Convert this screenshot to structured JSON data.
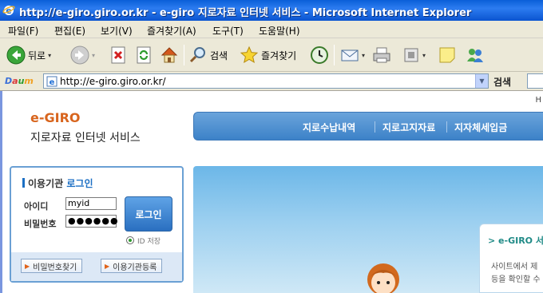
{
  "window": {
    "title": "http://e-giro.giro.or.kr - e-giro 지로자료 인터넷 서비스 - Microsoft Internet Explorer"
  },
  "menu": [
    "파일(F)",
    "편집(E)",
    "보기(V)",
    "즐겨찾기(A)",
    "도구(T)",
    "도움말(H)"
  ],
  "toolbar": {
    "back_label": "뒤로",
    "search_label": "검색",
    "favorites_label": "즐겨찾기"
  },
  "address": {
    "brand": "Daum",
    "url": "http://e-giro.giro.or.kr/",
    "search_label": "검색"
  },
  "page": {
    "logo": "e-GIRO",
    "logo_sub": "지로자료 인터넷 서비스",
    "corner_letter": "H",
    "nav": [
      "지로수납내역",
      "지로고지자료",
      "지자체세입금"
    ],
    "login": {
      "title_prefix": "이용기관",
      "title_accent": "로그인",
      "id_label": "아이디",
      "id_value": "myid",
      "pw_label": "비밀번호",
      "pw_value": "●●●●●●",
      "login_button": "로그인",
      "save_id_label": "ID 저장",
      "find_pw_button": "비밀번호찾기",
      "register_button": "이용기관등록"
    },
    "card": {
      "title": "> e-GIRO 서",
      "line1": "사이트에서 제",
      "line2": "등을 확인할 수"
    }
  },
  "colors": {
    "titlebar": "#0a5fd8",
    "nav": "#3c82c8",
    "accent_orange": "#d8651e"
  }
}
